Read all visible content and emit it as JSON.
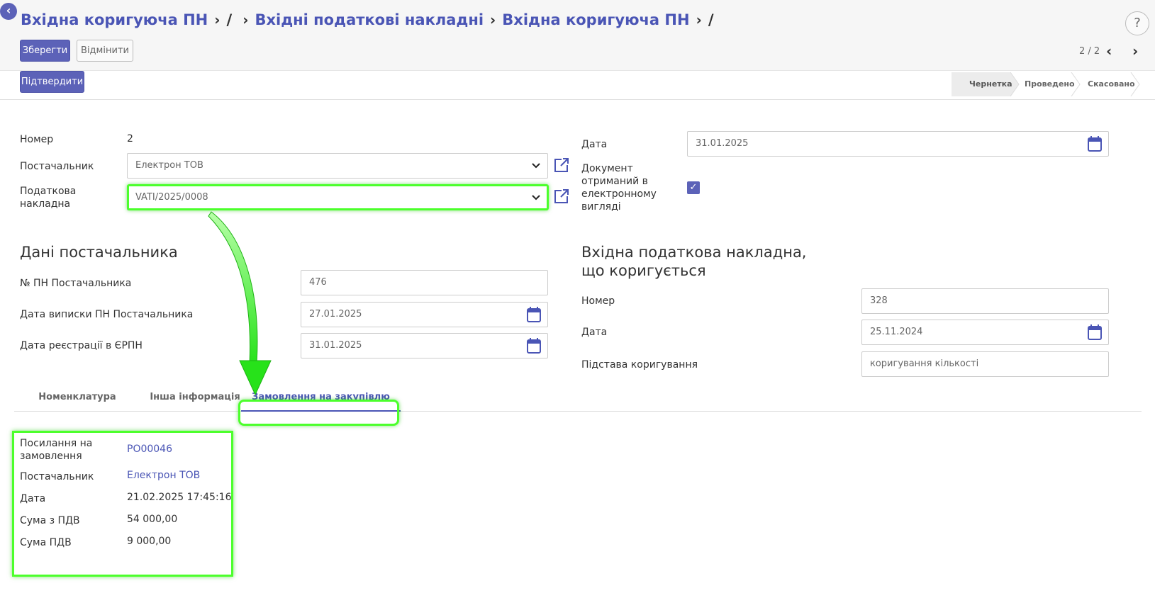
{
  "breadcrumb": {
    "items": [
      "Вхідна коригуюча ПН",
      "/",
      "Вхідні податкові накладні",
      "Вхідна коригуюча ПН",
      "/"
    ]
  },
  "toolbar": {
    "save_label": "Зберегти",
    "discard_label": "Відмінити",
    "confirm_label": "Підтвердити",
    "help_label": "?",
    "pager_label": "2 / 2"
  },
  "status": {
    "steps": [
      "Чернетка",
      "Проведено",
      "Скасовано"
    ],
    "active_index": 0
  },
  "header_form": {
    "number_label": "Номер",
    "number_value": "2",
    "supplier_label": "Постачальник",
    "supplier_value": "Електрон ТОВ",
    "tax_invoice_label": "Податкова накладна",
    "tax_invoice_value": "VATI/2025/0008",
    "date_label": "Дата",
    "date_value": "31.01.2025",
    "electronic_label": "Документ отриманий в електронному вигляді",
    "electronic_checked": true
  },
  "supplier_data": {
    "title": "Дані постачальника",
    "pn_number_label": "№ ПН Постачальника",
    "pn_number_value": "476",
    "issue_date_label": "Дата виписки ПН Постачальника",
    "issue_date_value": "27.01.2025",
    "erpn_date_label": "Дата реєстрації в ЄРПН",
    "erpn_date_value": "31.01.2025"
  },
  "corrected_invoice": {
    "title": "Вхідна податкова накладна, що коригується",
    "number_label": "Номер",
    "number_value": "328",
    "date_label": "Дата",
    "date_value": "25.11.2024",
    "reason_label": "Підстава коригування",
    "reason_value": "коригування кількості"
  },
  "tabs": [
    "Номенклатура",
    "Інша інформація",
    "Замовлення на закупівлю"
  ],
  "active_tab": 2,
  "purchase_order": {
    "ref_label": "Посилання на замовлення",
    "ref_value": "PO00046",
    "supplier_label": "Постачальник",
    "supplier_value": "Електрон ТОВ",
    "date_label": "Дата",
    "date_value": "21.02.2025 17:45:16",
    "total_label": "Сума з ПДВ",
    "total_value": "54 000,00",
    "vat_label": "Сума ПДВ",
    "vat_value": "9 000,00"
  },
  "colors": {
    "primary": "#5c62b8",
    "link": "#4a55b5",
    "highlight": "#4cff2c"
  }
}
